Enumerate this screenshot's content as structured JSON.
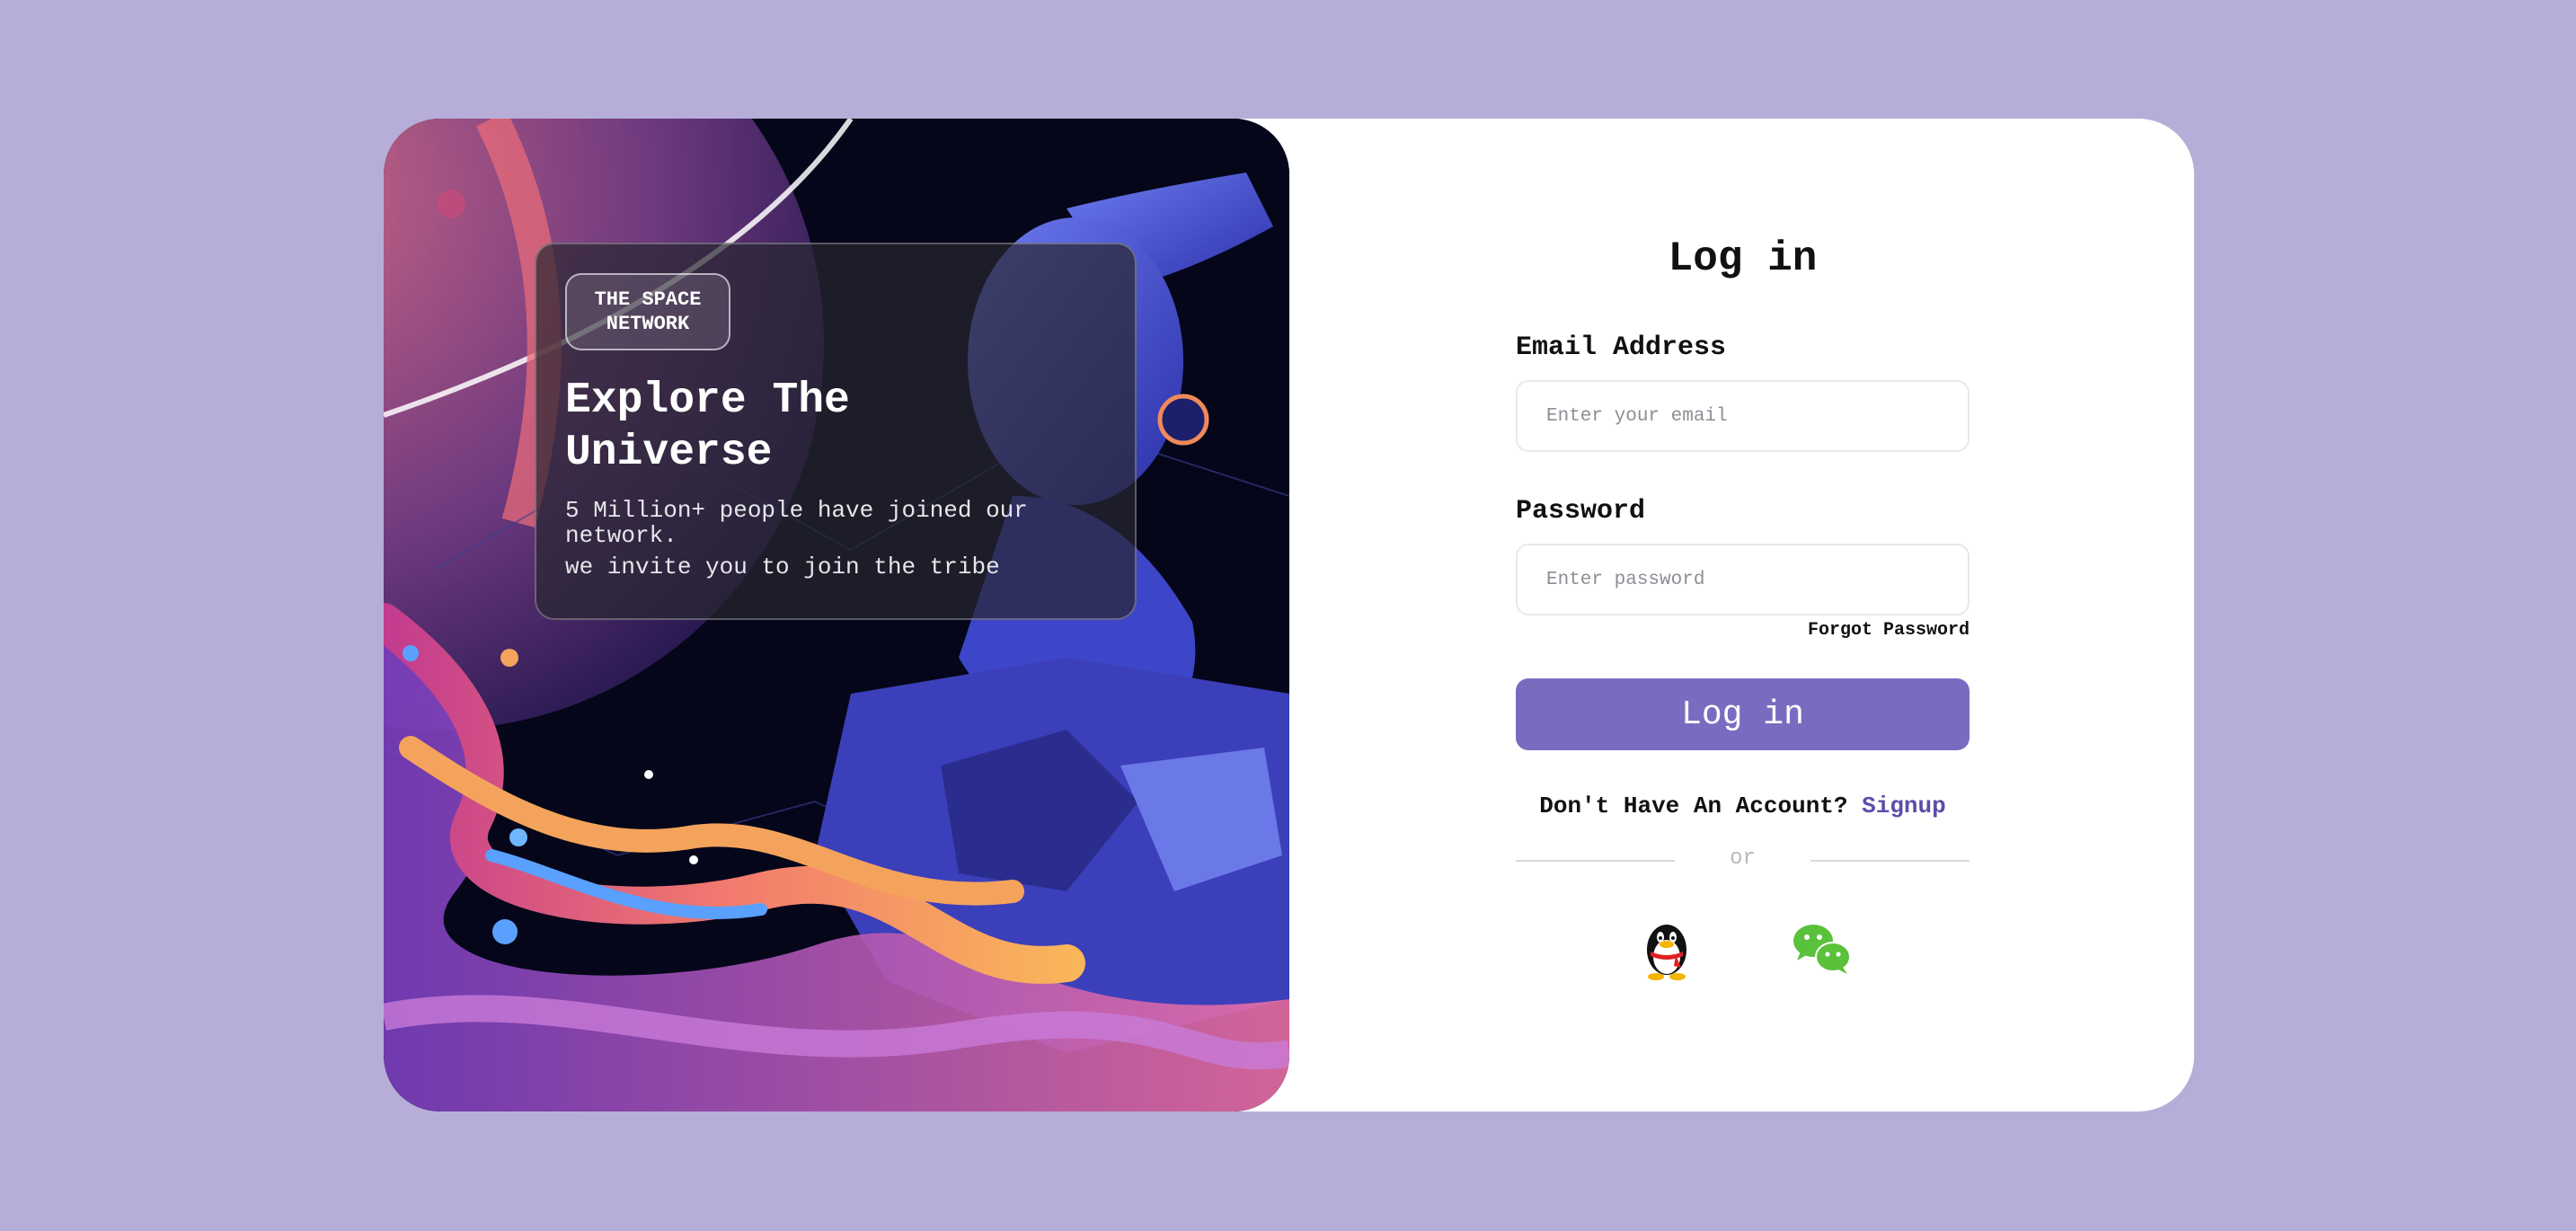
{
  "hero": {
    "badge_text": "THE SPACE NETWORK",
    "title": "Explore The Universe",
    "subtitle": "5 Million+ people have joined our network.",
    "subtitle2": "we invite you to join the tribe"
  },
  "form": {
    "title": "Log in",
    "email_label": "Email Address",
    "email_placeholder": "Enter your email",
    "email_value": "",
    "password_label": "Password",
    "password_placeholder": "Enter password",
    "password_value": "",
    "forgot_label": "Forgot Password",
    "submit_label": "Log in",
    "no_account_text": "Don't Have An Account?",
    "signup_label": "Signup",
    "divider_text": "or"
  },
  "social": [
    {
      "icon": "qq-penguin-icon"
    },
    {
      "icon": "wechat-icon"
    }
  ],
  "colors": {
    "background": "#b6aed8",
    "accent": "#7b6bc0",
    "link": "#5b4eaa"
  }
}
